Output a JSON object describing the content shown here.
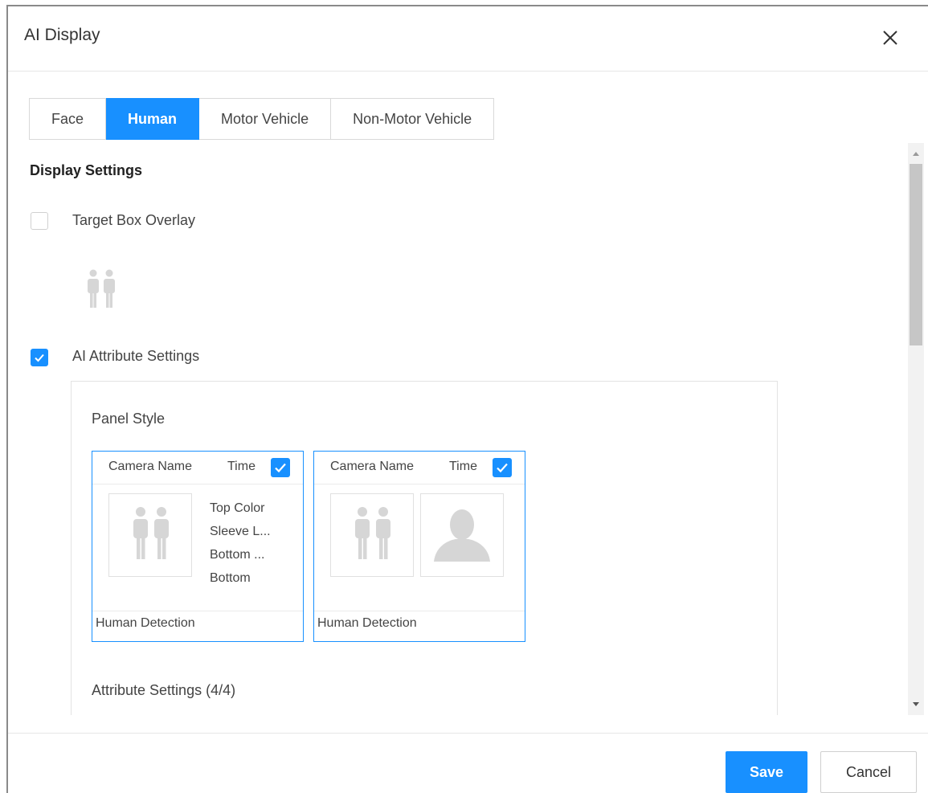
{
  "dialog": {
    "title": "AI Display",
    "close_label": "X"
  },
  "tabs": [
    {
      "label": "Face",
      "active": false
    },
    {
      "label": "Human",
      "active": true
    },
    {
      "label": "Motor Vehicle",
      "active": false
    },
    {
      "label": "Non-Motor Vehicle",
      "active": false
    }
  ],
  "display_settings": {
    "title": "Display Settings",
    "target_box_overlay": {
      "label": "Target Box Overlay",
      "checked": false
    },
    "target_icon": "people-icon",
    "ai_attribute_settings": {
      "label": "AI Attribute Settings",
      "checked": true
    }
  },
  "attribute_panel": {
    "panel_style_label": "Panel Style",
    "cards": [
      {
        "camera_name": "Camera Name",
        "time": "Time",
        "time_checked": true,
        "attributes": [
          "Top Color",
          "Sleeve L...",
          "Bottom ...",
          "Bottom"
        ],
        "footer": "Human Detection"
      },
      {
        "camera_name": "Camera Name",
        "time": "Time",
        "time_checked": true,
        "footer": "Human Detection"
      }
    ],
    "attribute_settings_label": "Attribute Settings (4/4)"
  },
  "footer": {
    "save_label": "Save",
    "cancel_label": "Cancel"
  },
  "colors": {
    "accent": "#1890ff",
    "border": "#d9d9d9",
    "icon_gray": "#d6d6d6"
  }
}
